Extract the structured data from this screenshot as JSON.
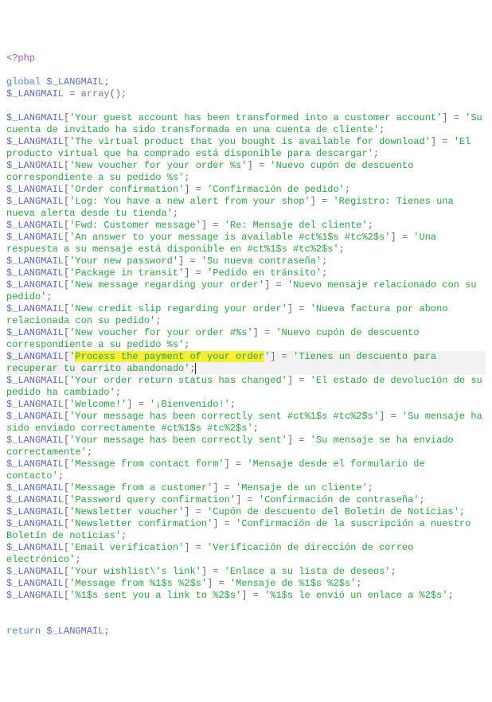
{
  "code": {
    "open_tag": "<?php",
    "kw_global": "global",
    "kw_return": "return",
    "var": "$_LANGMAIL",
    "fn_array": "array",
    "semi": ";",
    "eq": " = ",
    "lb": "[",
    "rb": "]",
    "po": "(",
    "pc": ")",
    "q": "'"
  },
  "decl_init": "array()",
  "entries": [
    {
      "key": "Your guest account has been transformed into a customer account",
      "val": "Su cuenta de invitado ha sido transformada en una cuenta de cliente"
    },
    {
      "key": "The virtual product that you bought is available for download",
      "val": "El producto virtual que ha comprado está disponible para descargar"
    },
    {
      "key": "New voucher for your order %s",
      "val": "Nuevo cupón de descuento correspondiente a su pedido %s"
    },
    {
      "key": "Order confirmation",
      "val": "Confirmación de pedido"
    },
    {
      "key": "Log: You have a new alert from your shop",
      "val": "Registro: Tienes una nueva alerta desde tu tienda"
    },
    {
      "key": "Fwd: Customer message",
      "val": "Re: Mensaje del cliente"
    },
    {
      "key": "An answer to your message is available #ct%1$s #tc%2$s",
      "val": "Una respuesta a su mensaje está disponible en #ct%1$s #tc%2$s"
    },
    {
      "key": "Your new password",
      "val": "Su nueva contraseña"
    },
    {
      "key": "Package in transit",
      "val": "Pedido en tránsito"
    },
    {
      "key": "New message regarding your order",
      "val": "Nuevo mensaje relacionado con su pedido"
    },
    {
      "key": "New credit slip regarding your order",
      "val": "Nueva factura por abono relacionada con su pedido"
    },
    {
      "key": "New voucher for your order #%s",
      "val": "Nuevo cupón de descuento correspondiente a su pedido %s"
    },
    {
      "key": "Process the payment of your order",
      "val": "Tienes un descuento para recuperar tu carrito abandonado",
      "highlight_key": true,
      "line_highlight": true
    },
    {
      "key": "Your order return status has changed",
      "val": "El estado de devolución de su pedido ha cambiado"
    },
    {
      "key": "Welcome!",
      "val": "¡Bienvenido!"
    },
    {
      "key": "Your message has been correctly sent #ct%1$s #tc%2$s",
      "val": "Su mensaje ha sido enviado correctamente #ct%1$s #tc%2$s"
    },
    {
      "key": "Your message has been correctly sent",
      "val": "Su mensaje se ha enviado correctamente"
    },
    {
      "key": "Message from contact form",
      "val": "Mensaje desde el formulario de contacto"
    },
    {
      "key": "Message from a customer",
      "val": "Mensaje de un cliente"
    },
    {
      "key": "Password query confirmation",
      "val": "Confirmación de contraseña"
    },
    {
      "key": "Newsletter voucher",
      "val": "Cupón de descuento del Boletín de Noticias"
    },
    {
      "key": "Newsletter confirmation",
      "val": "Confirmación de la suscripción a nuestro Boletín de noticias"
    },
    {
      "key": "Email verification",
      "val": "Verificación de dirección de correo electrónico"
    },
    {
      "key": "Your wishlist\\'s link",
      "val": "Enlace a su lista de deseos"
    },
    {
      "key": "Message from %1$s %2$s",
      "val": "Mensaje de %1$s %2$s"
    },
    {
      "key": "%1$s sent you a link to %2$s",
      "val": "%1$s le envió un enlace a %2$s"
    }
  ]
}
